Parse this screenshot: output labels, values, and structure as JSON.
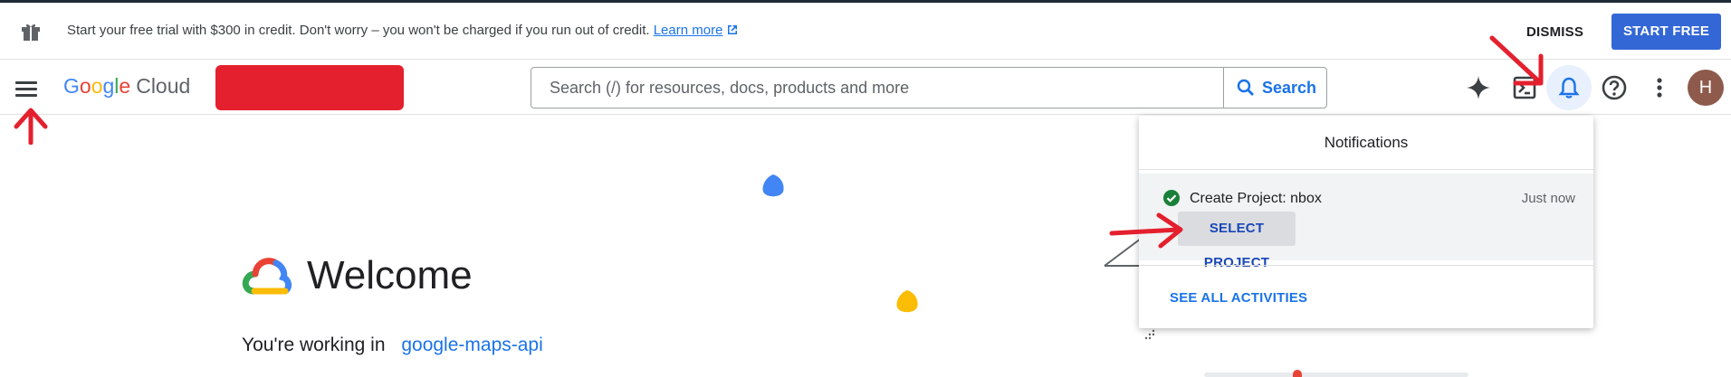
{
  "banner": {
    "message": "Start your free trial with $300 in credit. Don't worry – you won't be charged if you run out of credit.",
    "learn_more": "Learn more",
    "dismiss_label": "DISMISS",
    "start_free_label": "START FREE"
  },
  "header": {
    "logo_google": "Google",
    "logo_cloud": "Cloud",
    "search_placeholder": "Search (/) for resources, docs, products and more",
    "search_button_label": "Search",
    "avatar_initial": "H",
    "icons": [
      "menu-icon",
      "gemini-sparkle-icon",
      "cloud-shell-icon",
      "notifications-bell-icon",
      "help-icon",
      "more-vert-icon"
    ]
  },
  "welcome": {
    "title": "Welcome",
    "working_in_label": "You're working in",
    "project_name": "google-maps-api"
  },
  "notifications": {
    "title": "Notifications",
    "items": [
      {
        "text": "Create Project: nbox",
        "time": "Just now",
        "action_label": "SELECT PROJECT",
        "status": "success"
      }
    ],
    "see_all_label": "SEE ALL ACTIVITIES"
  },
  "colors": {
    "accent_blue": "#1a73e8",
    "start_free_bg": "#3367d6",
    "success_green": "#188038",
    "annotation_red": "#e4202e",
    "avatar_bg": "#8d5a4b"
  }
}
